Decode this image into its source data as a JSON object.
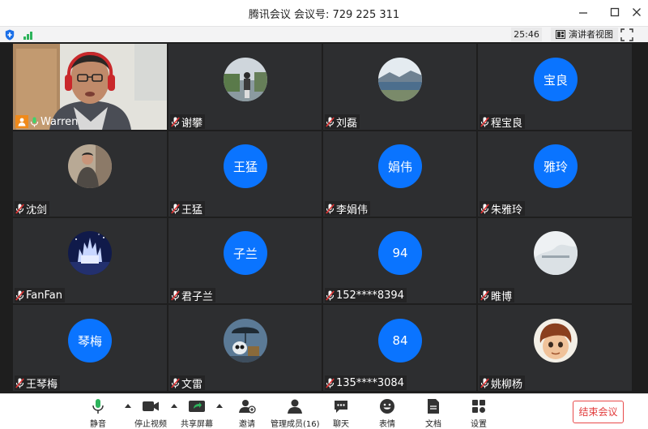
{
  "window": {
    "title": "腾讯会议 会议号: 729 225 311",
    "controls": [
      "minimize",
      "maximize",
      "close"
    ]
  },
  "status": {
    "timer": "25:46",
    "speaker_view_label": "演讲者视图",
    "icons": [
      "shield-icon",
      "signal-icon",
      "fullscreen-icon"
    ]
  },
  "participants": [
    {
      "name": "Warren",
      "avatar": "video",
      "mic": "on",
      "host": true
    },
    {
      "name": "谢攀",
      "avatar": "photo-lake",
      "mic": "muted"
    },
    {
      "name": "刘磊",
      "avatar": "photo-landscape",
      "mic": "muted"
    },
    {
      "name": "程宝良",
      "avatar_text": "宝良",
      "mic": "muted"
    },
    {
      "name": "沈剑",
      "avatar": "photo-person",
      "mic": "muted"
    },
    {
      "name": "王猛",
      "avatar_text": "王猛",
      "mic": "muted"
    },
    {
      "name": "李娟伟",
      "avatar_text": "娟伟",
      "mic": "muted"
    },
    {
      "name": "朱雅玲",
      "avatar_text": "雅玲",
      "mic": "muted"
    },
    {
      "name": "FanFan",
      "avatar": "photo-castle",
      "mic": "muted"
    },
    {
      "name": "君子兰",
      "avatar_text": "子兰",
      "mic": "muted"
    },
    {
      "name": "152****8394",
      "avatar_text": "94",
      "mic": "muted"
    },
    {
      "name": "睢博",
      "avatar": "photo-snow",
      "mic": "muted"
    },
    {
      "name": "王琴梅",
      "avatar_text": "琴梅",
      "mic": "muted"
    },
    {
      "name": "文雷",
      "avatar": "photo-robot",
      "mic": "muted"
    },
    {
      "name": "135****3084",
      "avatar_text": "84",
      "mic": "muted"
    },
    {
      "name": "姚柳杨",
      "avatar": "photo-cartoon",
      "mic": "muted"
    }
  ],
  "toolbar": {
    "mute": "静音",
    "stop_video": "停止视频",
    "share_screen": "共享屏幕",
    "invite": "邀请",
    "manage_members": "管理成员(16)",
    "chat": "聊天",
    "reactions": "表情",
    "docs": "文档",
    "settings": "设置",
    "end_meeting": "结束会议"
  },
  "colors": {
    "accent_blue": "#0a74ff",
    "mic_green": "#2db35b",
    "end_red": "#e23b3b",
    "tile_bg": "#2d2e30"
  }
}
